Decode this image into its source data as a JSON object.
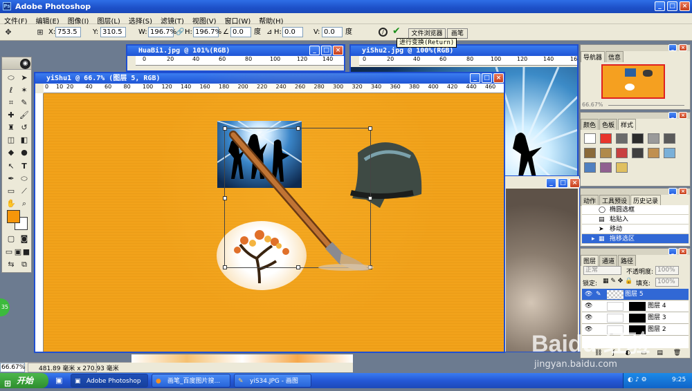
{
  "app": {
    "title": "Adobe Photoshop"
  },
  "menu": [
    "文件(F)",
    "编辑(E)",
    "图像(I)",
    "图层(L)",
    "选择(S)",
    "滤镜(T)",
    "视图(V)",
    "窗口(W)",
    "帮助(H)"
  ],
  "options": {
    "x_label": "X:",
    "x": "753.5 ",
    "y_label": "Y:",
    "y": "310.5 ",
    "w_label": "W:",
    "w": "196.7%",
    "h_label": "H:",
    "h": "196.7%",
    "angle": "0.0",
    "deg": "度",
    "hs_label": "H:",
    "hs": "0.0",
    "vs_label": "V:",
    "vs": "0.0",
    "deg2": "度",
    "tab_browser": "文件浏览器",
    "tab_brush": "画笔",
    "tooltip": "进行变换(Return)"
  },
  "docs": {
    "huabi": {
      "title": "HuaBi1.jpg @ 101%(RGB)"
    },
    "yishu2": {
      "title": "yiShu2.jpg @ 100%(RGB)"
    },
    "yishu1": {
      "title": "yiShu1 @ 66.7% (图层 5, RGB)",
      "ruler": [
        "0",
        "10",
        "20",
        "40",
        "60",
        "80",
        "100",
        "120",
        "140",
        "160",
        "180",
        "200",
        "220",
        "240",
        "260",
        "280",
        "300",
        "320",
        "340",
        "360",
        "380",
        "400",
        "420",
        "440",
        "460"
      ]
    }
  },
  "nav": {
    "tab1": "导航器",
    "tab2": "信息",
    "zoom": "66.67%"
  },
  "swatches": {
    "tab1": "颜色",
    "tab2": "色板",
    "tab3": "样式",
    "colors": [
      "#ffffff",
      "#e8352c",
      "#6a6a6a",
      "#2c2c2c",
      "#9a9a9a",
      "#5a5a5a",
      "#8a6a3a",
      "#b08a4a",
      "#c84040",
      "#404040",
      "#c09050",
      "#7ab0d8",
      "#5080c0",
      "#906090",
      "#e0c060"
    ]
  },
  "history": {
    "tab1": "动作",
    "tab2": "工具预设",
    "tab3": "历史记录",
    "items": [
      "椭圆选框",
      "粘贴入",
      "移动",
      "拖移选区"
    ]
  },
  "layers": {
    "tab1": "图层",
    "tab2": "通道",
    "tab3": "路径",
    "blend": "正常",
    "opacity_label": "不透明度:",
    "opacity": "100%",
    "lock_label": "锁定:",
    "fill_label": "填充:",
    "fill": "100%",
    "items": [
      "图层 5",
      "图层 4",
      "图层 3",
      "图层 2"
    ]
  },
  "status": {
    "zoom": "66.67%",
    "size": "481.89 毫米 x 270.93 毫米"
  },
  "taskbar": {
    "start": "开始",
    "items": [
      "Adobe Photoshop",
      "画笔_百度图片搜...",
      "yiS34.JPG - 画图"
    ],
    "time": "9:25"
  },
  "watermark": {
    "logo": "Baidu 经验",
    "url": "jingyan.baidu.com"
  },
  "side_badge": "35"
}
